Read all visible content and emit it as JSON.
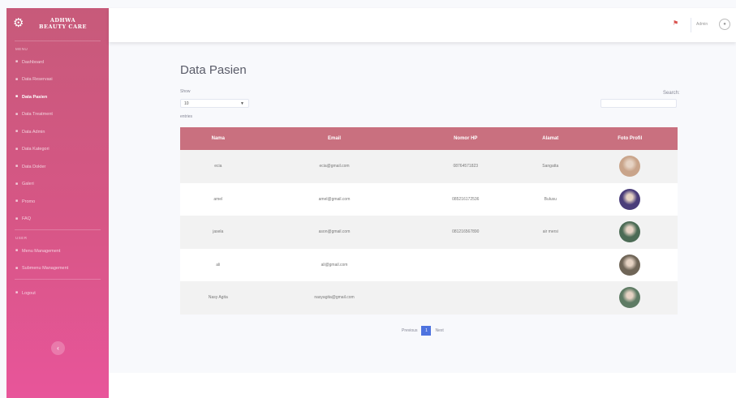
{
  "brand": {
    "line1": "ADHWA",
    "line2": "BEAUTY CARE",
    "icon": "gear-icon"
  },
  "sidebar": {
    "heading_main": "MENU",
    "items": [
      {
        "label": "Dashboard",
        "icon": "dashboard-icon",
        "active": false
      },
      {
        "label": "Data Reservasi",
        "icon": "calendar-icon",
        "active": false
      },
      {
        "label": "Data Pasien",
        "icon": "users-icon",
        "active": true
      },
      {
        "label": "Data Treatment",
        "icon": "list-icon",
        "active": false
      },
      {
        "label": "Data Admin",
        "icon": "user-icon",
        "active": false
      },
      {
        "label": "Data Kategori",
        "icon": "tag-icon",
        "active": false
      },
      {
        "label": "Data Dokter",
        "icon": "doctor-icon",
        "active": false
      },
      {
        "label": "Galeri",
        "icon": "image-icon",
        "active": false
      },
      {
        "label": "Promo",
        "icon": "percent-icon",
        "active": false
      },
      {
        "label": "FAQ",
        "icon": "question-icon",
        "active": false
      }
    ],
    "heading_user": "USER",
    "items2": [
      {
        "label": "Menu Management",
        "icon": "menu-icon"
      },
      {
        "label": "Submenu Management",
        "icon": "submenu-icon"
      }
    ],
    "logout": "Logout",
    "toggle_icon": "chevron-left-icon"
  },
  "topbar": {
    "user_name": "Admin",
    "bell_icon": "bell-icon",
    "avatar_icon": "avatar-icon"
  },
  "page": {
    "title": "Data Pasien",
    "show_label": "Show",
    "show_value": "10",
    "entries_label": "entries",
    "search_label": "Search:",
    "search_value": ""
  },
  "table": {
    "headers": [
      "Nama",
      "Email",
      "Nomor HP",
      "Alamat",
      "Foto Profil"
    ],
    "rows": [
      {
        "nama": "ecia",
        "email": "ecia@gmail.com",
        "hp": "08764571823",
        "alamat": "Sangatta",
        "photo_color": "#c9a48a"
      },
      {
        "nama": "amel",
        "email": "amel@gmail.com",
        "hp": "085216172536",
        "alamat": "Bulusu",
        "photo_color": "#4a3d7a"
      },
      {
        "nama": "jasela",
        "email": "ason@gmail.com",
        "hp": "081216567890",
        "alamat": "air mersi",
        "photo_color": "#4c6b55"
      },
      {
        "nama": "ali",
        "email": "ali@gmail.com",
        "hp": "",
        "alamat": "",
        "photo_color": "#6f6557"
      },
      {
        "nama": "Nasy Agita",
        "email": "nasyagita@gmail.com",
        "hp": "",
        "alamat": "",
        "photo_color": "#5e7b64"
      }
    ]
  },
  "pager": {
    "prev": "Previous",
    "page": "1",
    "next": "Next"
  }
}
